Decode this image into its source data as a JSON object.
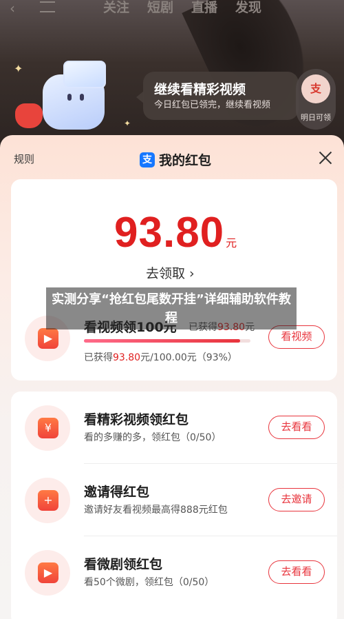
{
  "top_nav": {
    "tabs": [
      "关注",
      "短剧",
      "直播",
      "发现"
    ]
  },
  "bubble": {
    "title": "继续看精彩视频",
    "subtitle": "今日红包已领完，继续看视频"
  },
  "side_badge": {
    "icon_text": "支",
    "label": "明日可领"
  },
  "sheet": {
    "rule_label": "规则",
    "title": "我的红包",
    "alipay_glyph": "支"
  },
  "balance": {
    "amount": "93.80",
    "unit": "元",
    "claim_label": "去领取 ›"
  },
  "watch_task": {
    "title": "看视频领100元",
    "earned_inline": "已获得",
    "earned_value": "93.80",
    "earned_unit": "元",
    "progress_prefix": "已获得",
    "progress_value": "93.80",
    "progress_suffix": "元/100.00元（93%）",
    "progress_fraction": 0.938,
    "button": "看视频"
  },
  "tasks": [
    {
      "title": "看精彩视频领红包",
      "subtitle": "看的多赚的多，领红包（0/50）",
      "button": "去看看",
      "icon": "yuan-icon",
      "glyph": "¥"
    },
    {
      "title": "邀请得红包",
      "subtitle": "邀请好友看视频最高得888元红包",
      "button": "去邀请",
      "icon": "invite-user-icon",
      "glyph": "+"
    },
    {
      "title": "看微剧领红包",
      "subtitle": "看50个微剧，领红包（0/50）",
      "button": "去看看",
      "icon": "tv-play-icon",
      "glyph": "▶"
    }
  ],
  "overlay_text": "实测分享“抢红包尾数开挂”详细辅助软件教程",
  "colors": {
    "accent": "#e8343c",
    "amount": "#e02020",
    "alipay": "#1677ff"
  }
}
